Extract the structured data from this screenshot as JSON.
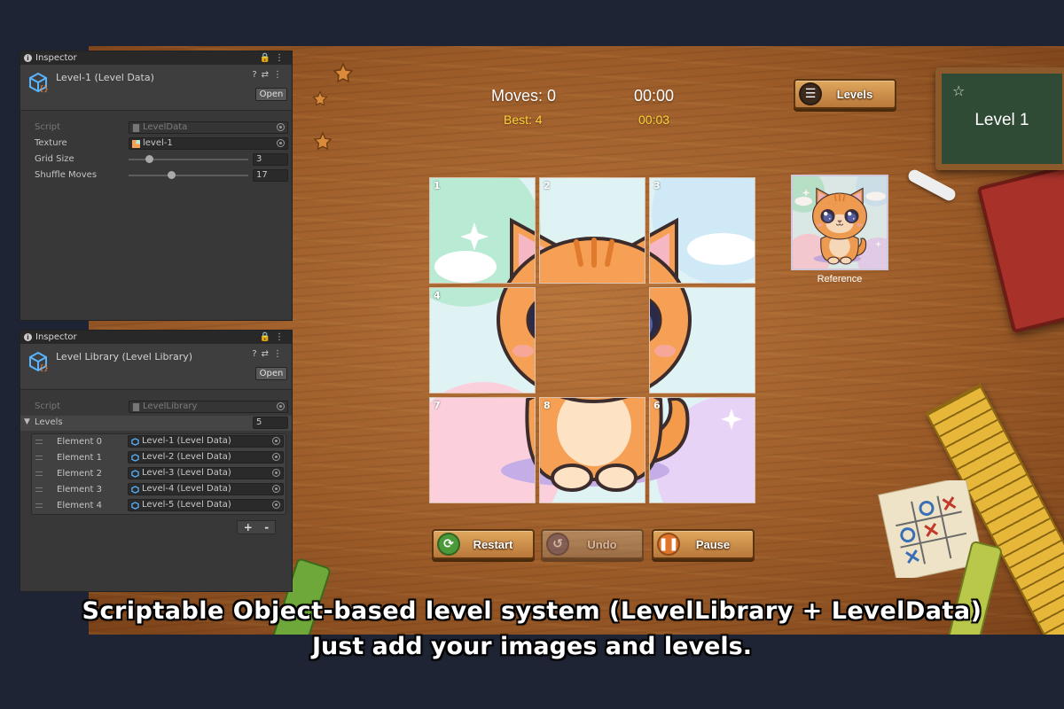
{
  "game": {
    "moves_label": "Moves: 0",
    "timer": "00:00",
    "best_label": "Best: 4",
    "best_time": "00:03",
    "levels_button": "Levels",
    "level_title": "Level 1",
    "reference_label": "Reference",
    "tiles": [
      {
        "num": "1",
        "filled": true
      },
      {
        "num": "2",
        "filled": true
      },
      {
        "num": "3",
        "filled": true
      },
      {
        "num": "4",
        "filled": true
      },
      {
        "num": "",
        "filled": false
      },
      {
        "num": "",
        "filled": true
      },
      {
        "num": "7",
        "filled": true
      },
      {
        "num": "8",
        "filled": true
      },
      {
        "num": "6",
        "filled": true
      }
    ],
    "buttons": {
      "restart": "Restart",
      "undo": "Undo",
      "pause": "Pause"
    },
    "icons": {
      "restart": "refresh-icon",
      "undo": "undo-icon",
      "pause": "pause-icon",
      "levels": "ladder-icon"
    }
  },
  "inspector1": {
    "tab": "Inspector",
    "title": "Level-1 (Level Data)",
    "open_label": "Open",
    "script_label": "Script",
    "script_value": "LevelData",
    "texture_label": "Texture",
    "texture_value": "level-1",
    "grid_label": "Grid Size",
    "grid_value": "3",
    "grid_fraction": 0.15,
    "shuffle_label": "Shuffle Moves",
    "shuffle_value": "17",
    "shuffle_fraction": 0.35
  },
  "inspector2": {
    "tab": "Inspector",
    "title": "Level Library (Level Library)",
    "open_label": "Open",
    "script_label": "Script",
    "script_value": "LevelLibrary",
    "levels_label": "Levels",
    "levels_count": "5",
    "elements": [
      {
        "name": "Element 0",
        "value": "Level-1 (Level Data)"
      },
      {
        "name": "Element 1",
        "value": "Level-2 (Level Data)"
      },
      {
        "name": "Element 2",
        "value": "Level-3 (Level Data)"
      },
      {
        "name": "Element 3",
        "value": "Level-4 (Level Data)"
      },
      {
        "name": "Element 4",
        "value": "Level-5 (Level Data)"
      }
    ],
    "plus": "+",
    "minus": "-"
  },
  "caption": {
    "line1": "Scriptable Object-based level system (LevelLibrary + LevelData)",
    "line2": "Just add your images and levels."
  },
  "colors": {
    "wood": "#9c5c29",
    "chalkboard": "#2f4a35",
    "inspector_bg": "#383838",
    "best_text": "#ffd23a"
  }
}
